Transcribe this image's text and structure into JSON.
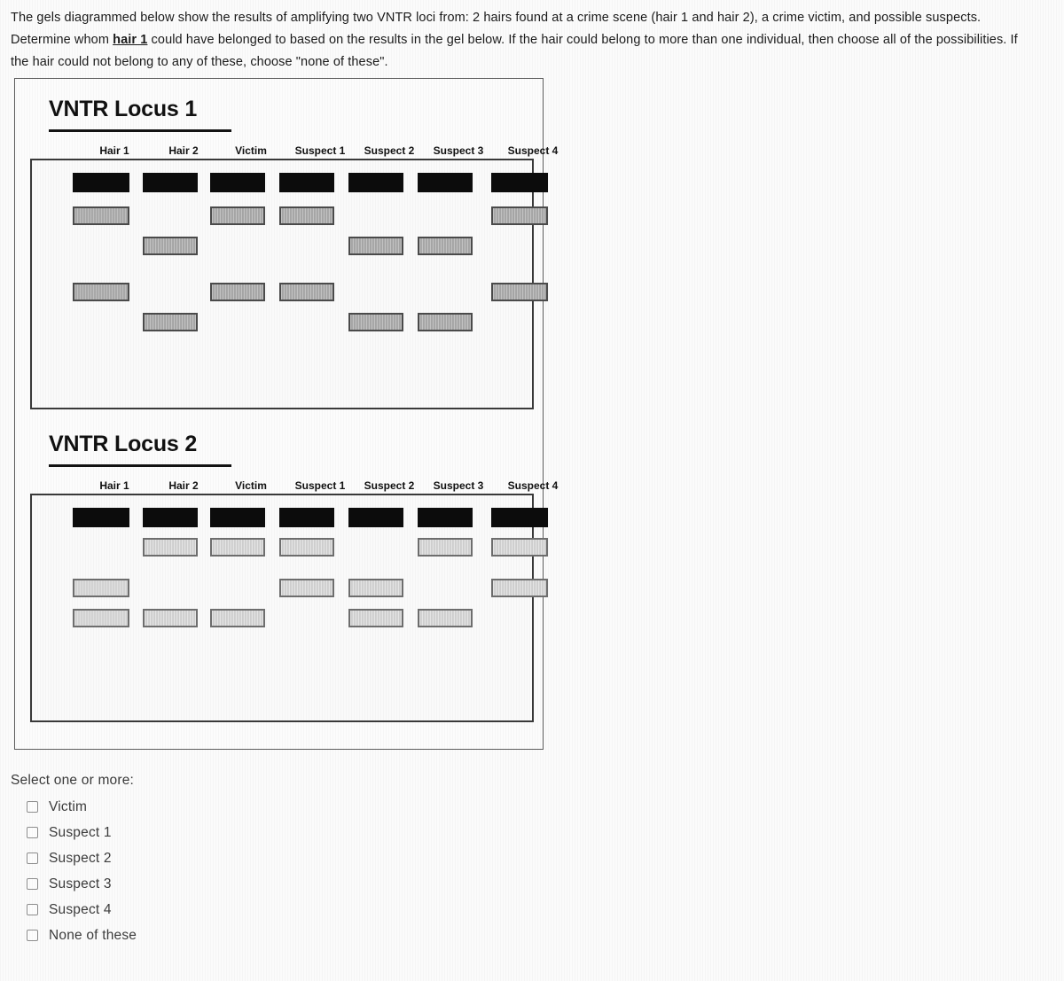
{
  "prompt": {
    "part1": "The gels diagrammed below show the results of amplifying two VNTR loci from: 2 hairs found at a crime scene (hair 1 and hair 2), a crime victim, and possible suspects. Determine whom ",
    "emphasis": "hair 1",
    "part2": " could have belonged to based on the results in the gel below. If the hair could belong to more than one individual, then choose all of the possibilities. If the hair could not belong to any of these, choose \"none of these\"."
  },
  "lanes": [
    "Hair 1",
    "Hair 2",
    "Victim",
    "Suspect 1",
    "Suspect 2",
    "Suspect 3",
    "Suspect 4"
  ],
  "gels": [
    {
      "title": "VNTR Locus 1",
      "rows": [
        {
          "type": "loading",
          "lanes": [
            1,
            1,
            1,
            1,
            1,
            1,
            1
          ]
        },
        {
          "type": "allele-1",
          "lanes": [
            1,
            0,
            1,
            1,
            0,
            0,
            1
          ]
        },
        {
          "type": "allele-1",
          "lanes": [
            0,
            1,
            0,
            0,
            1,
            1,
            0
          ]
        },
        {
          "type": "allele-1",
          "lanes": [
            1,
            0,
            1,
            1,
            0,
            0,
            1
          ]
        },
        {
          "type": "allele-1",
          "lanes": [
            0,
            1,
            0,
            0,
            1,
            1,
            0
          ]
        }
      ]
    },
    {
      "title": "VNTR Locus 2",
      "rows": [
        {
          "type": "loading",
          "lanes": [
            1,
            1,
            1,
            1,
            1,
            1,
            1
          ]
        },
        {
          "type": "allele-2",
          "lanes": [
            0,
            1,
            1,
            1,
            0,
            1,
            1
          ]
        },
        {
          "type": "allele-2",
          "lanes": [
            1,
            0,
            0,
            1,
            1,
            0,
            1
          ]
        },
        {
          "type": "allele-2",
          "lanes": [
            1,
            1,
            1,
            0,
            1,
            1,
            0
          ]
        }
      ]
    }
  ],
  "answers": {
    "prompt": "Select one or more:",
    "choices": [
      {
        "label": "Victim",
        "checked": false
      },
      {
        "label": "Suspect 1",
        "checked": false
      },
      {
        "label": "Suspect 2",
        "checked": false
      },
      {
        "label": "Suspect 3",
        "checked": false
      },
      {
        "label": "Suspect 4",
        "checked": false
      },
      {
        "label": "None of these",
        "checked": false
      }
    ]
  },
  "colors": {
    "loading_band": "#0c0c0c",
    "allele_band_locus1": "#a8a8a8",
    "allele_band_locus2": "#d2d2d2",
    "border": "#3a3a3a",
    "text": "#1c1c1c"
  },
  "layout": {
    "lane_centers": [
      78,
      156,
      232,
      310,
      388,
      466,
      550
    ],
    "lane_widths": [
      64,
      62,
      62,
      62,
      62,
      62,
      64
    ],
    "row_tops_locus1": [
      14,
      52,
      86,
      138,
      172
    ],
    "row_tops_locus2": [
      14,
      48,
      94,
      128
    ],
    "band_height_loading": 22,
    "band_height_allele": 21
  }
}
